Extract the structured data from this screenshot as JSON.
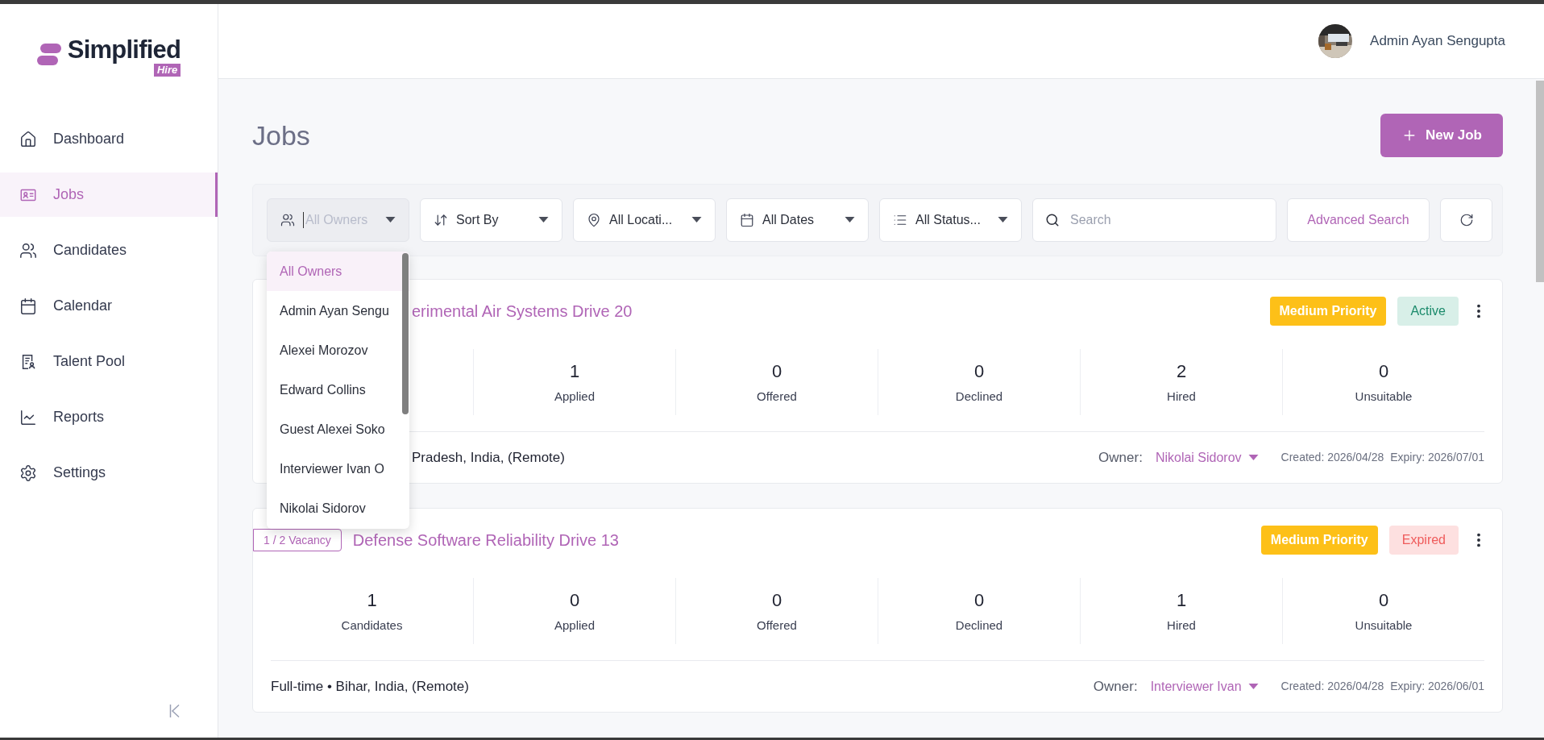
{
  "brand": {
    "name": "Simplified",
    "tag": "Hire"
  },
  "sidebar": {
    "items": [
      {
        "label": "Dashboard",
        "selected": false
      },
      {
        "label": "Jobs",
        "selected": true
      },
      {
        "label": "Candidates",
        "selected": false
      },
      {
        "label": "Calendar",
        "selected": false
      },
      {
        "label": "Talent Pool",
        "selected": false
      },
      {
        "label": "Reports",
        "selected": false
      },
      {
        "label": "Settings",
        "selected": false
      }
    ]
  },
  "user": {
    "name": "Admin Ayan Sengupta"
  },
  "page": {
    "title": "Jobs",
    "new_button": "New Job"
  },
  "filters": [
    {
      "kind": "select",
      "placeholder": "All Owners",
      "focused": true
    },
    {
      "kind": "select",
      "value": "Sort By",
      "focused": false
    },
    {
      "kind": "select",
      "value": "All Locati...",
      "focused": false
    },
    {
      "kind": "select",
      "value": "All Dates",
      "focused": false
    },
    {
      "kind": "select",
      "value": "All Status...",
      "focused": false
    },
    {
      "kind": "search",
      "placeholder": "Search"
    },
    {
      "kind": "link",
      "label": "Advanced Search"
    },
    {
      "kind": "refresh"
    }
  ],
  "owner_menu": {
    "items": [
      {
        "label": "All Owners",
        "selected": true
      },
      {
        "label": "Admin Ayan Sengu",
        "selected": false
      },
      {
        "label": "Alexei Morozov",
        "selected": false
      },
      {
        "label": "Edward Collins",
        "selected": false
      },
      {
        "label": "Guest Alexei Soko",
        "selected": false
      },
      {
        "label": "Interviewer Ivan O",
        "selected": false
      },
      {
        "label": "Nikolai Sidorov",
        "selected": false
      }
    ]
  },
  "jobs": [
    {
      "partly_covered": true,
      "title": "erimental Air Systems Drive 20",
      "priority": "Medium Priority",
      "status": {
        "label": "Active",
        "kind": "active"
      },
      "stats": [
        {
          "value": "1",
          "label": "Applied"
        },
        {
          "value": "0",
          "label": "Offered"
        },
        {
          "value": "0",
          "label": "Declined"
        },
        {
          "value": "2",
          "label": "Hired"
        },
        {
          "value": "0",
          "label": "Unsuitable"
        }
      ],
      "details": "Pradesh, India, (Remote)",
      "owner_label": "Owner:",
      "owner": "Nikolai Sidorov",
      "created": "Created: 2026/04/28",
      "expiry": "Expiry: 2026/07/01"
    },
    {
      "partly_covered": false,
      "vacancy": "1 / 2 Vacancy",
      "title": "Defense Software Reliability Drive 13",
      "priority": "Medium Priority",
      "status": {
        "label": "Expired",
        "kind": "expired"
      },
      "stats": [
        {
          "value": "1",
          "label": "Candidates"
        },
        {
          "value": "0",
          "label": "Applied"
        },
        {
          "value": "0",
          "label": "Offered"
        },
        {
          "value": "0",
          "label": "Declined"
        },
        {
          "value": "1",
          "label": "Hired"
        },
        {
          "value": "0",
          "label": "Unsuitable"
        }
      ],
      "details": "Full-time • Bihar, India, (Remote)",
      "owner_label": "Owner:",
      "owner": "Interviewer Ivan",
      "created": "Created: 2026/04/28",
      "expiry": "Expiry: 2026/06/01"
    }
  ]
}
